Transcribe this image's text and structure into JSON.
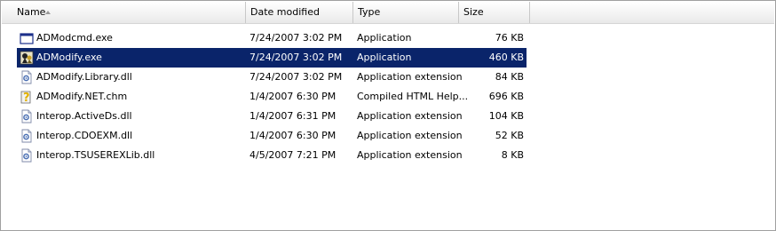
{
  "columns": {
    "name": "Name",
    "date": "Date modified",
    "type": "Type",
    "size": "Size"
  },
  "files": [
    {
      "name": "ADModcmd.exe",
      "date": "7/24/2007 3:02 PM",
      "type": "Application",
      "size": "76 KB",
      "icon": "console-window-icon",
      "selected": false
    },
    {
      "name": "ADModify.exe",
      "date": "7/24/2007 3:02 PM",
      "type": "Application",
      "size": "460 KB",
      "icon": "admodify-app-icon",
      "selected": true
    },
    {
      "name": "ADModify.Library.dll",
      "date": "7/24/2007 3:02 PM",
      "type": "Application extension",
      "size": "84 KB",
      "icon": "dll-gear-icon",
      "selected": false
    },
    {
      "name": "ADModify.NET.chm",
      "date": "1/4/2007 6:30 PM",
      "type": "Compiled HTML Help...",
      "size": "696 KB",
      "icon": "help-file-icon",
      "selected": false
    },
    {
      "name": "Interop.ActiveDs.dll",
      "date": "1/4/2007 6:31 PM",
      "type": "Application extension",
      "size": "104 KB",
      "icon": "dll-gear-icon",
      "selected": false
    },
    {
      "name": "Interop.CDOEXM.dll",
      "date": "1/4/2007 6:30 PM",
      "type": "Application extension",
      "size": "52 KB",
      "icon": "dll-gear-icon",
      "selected": false
    },
    {
      "name": "Interop.TSUSEREXLib.dll",
      "date": "4/5/2007 7:21 PM",
      "type": "Application extension",
      "size": "8 KB",
      "icon": "dll-gear-icon",
      "selected": false
    }
  ],
  "colors": {
    "selection": "#0a246a",
    "header_border": "#c8c8c8"
  }
}
